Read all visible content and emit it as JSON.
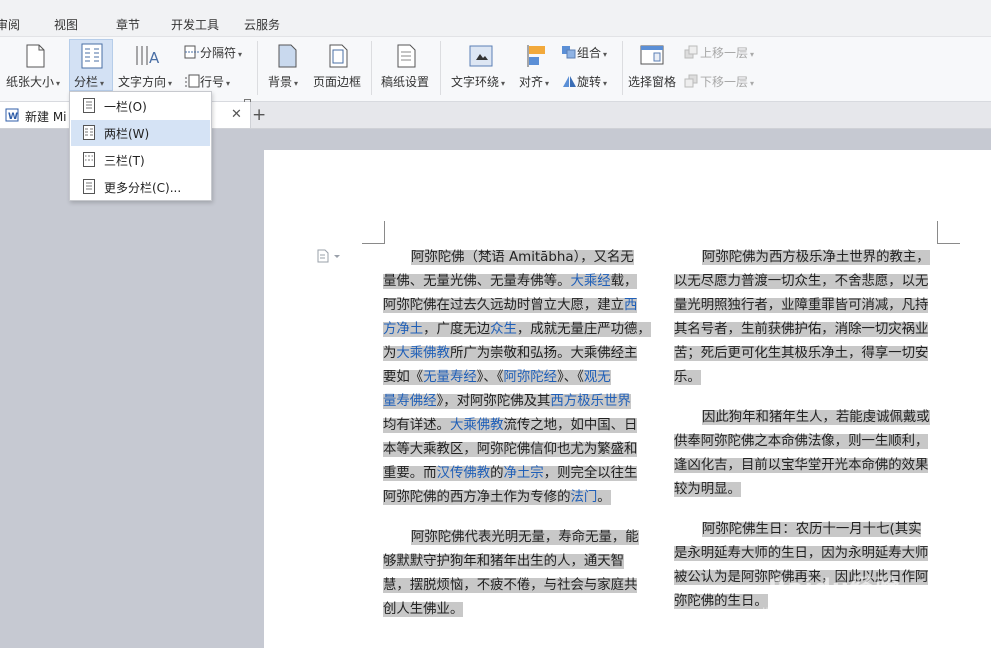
{
  "menubar": {
    "items": [
      "审阅",
      "视图",
      "章节",
      "开发工具",
      "云服务"
    ]
  },
  "ribbon": {
    "paper_size": "纸张大小",
    "columns": "分栏",
    "text_direction": "文字方向",
    "separator": "分隔符",
    "line_number": "行号",
    "background": "背景",
    "page_border": "页面边框",
    "manuscript": "稿纸设置",
    "text_wrap": "文字环绕",
    "align": "对齐",
    "group": "组合",
    "rotate": "旋转",
    "selection_pane": "选择窗格",
    "bring_forward": "上移一层",
    "send_backward": "下移一层"
  },
  "tabs": {
    "doc_title": "新建 Mi"
  },
  "dropdown": {
    "items": [
      "一栏(O)",
      "两栏(W)",
      "三栏(T)",
      "更多分栏(C)..."
    ],
    "selected": "两栏(W)"
  },
  "document": {
    "left_column": {
      "p1_lines": [
        [
          {
            "t": "阿弥陀佛（梵语 Amitābha），又名无"
          }
        ],
        [
          {
            "t": "量佛、无量光佛、无量寿佛等。"
          },
          {
            "t": "大乘经",
            "link": true
          },
          {
            "t": "载，"
          }
        ],
        [
          {
            "t": "阿弥陀佛在过去久远劫时曾立大愿，建立"
          },
          {
            "t": "西",
            "link": true
          }
        ],
        [
          {
            "t": "方净土",
            "link": true
          },
          {
            "t": "，广度无边"
          },
          {
            "t": "众生",
            "link": true
          },
          {
            "t": "，成就无量庄严功德，"
          }
        ],
        [
          {
            "t": "为"
          },
          {
            "t": "大乘佛教",
            "link": true
          },
          {
            "t": "所广为崇敬和弘扬。大乘佛经主"
          }
        ],
        [
          {
            "t": "要如《"
          },
          {
            "t": "无量寿经",
            "link": true
          },
          {
            "t": "》、《"
          },
          {
            "t": "阿弥陀经",
            "link": true
          },
          {
            "t": "》、《"
          },
          {
            "t": "观无",
            "link": true
          }
        ],
        [
          {
            "t": "量寿佛经",
            "link": true
          },
          {
            "t": "》，对阿弥陀佛及其"
          },
          {
            "t": "西方极乐世界",
            "link": true
          }
        ],
        [
          {
            "t": "均有详述。"
          },
          {
            "t": "大乘佛教",
            "link": true
          },
          {
            "t": "流传之地，如中国、日"
          }
        ],
        [
          {
            "t": "本等大乘教区，阿弥陀佛信仰也尤为繁盛和"
          }
        ],
        [
          {
            "t": "重要。而"
          },
          {
            "t": "汉传佛教",
            "link": true
          },
          {
            "t": "的"
          },
          {
            "t": "净土宗",
            "link": true
          },
          {
            "t": "，则完全以往生"
          }
        ],
        [
          {
            "t": "阿弥陀佛的西方净土作为专修的"
          },
          {
            "t": "法门",
            "link": true
          },
          {
            "t": "。"
          }
        ]
      ],
      "p2_lines": [
        [
          {
            "t": "阿弥陀佛代表光明无量，寿命无量，能"
          }
        ],
        [
          {
            "t": "够默默守护狗年和猪年出生的人，通天智"
          }
        ],
        [
          {
            "t": "慧，摆脱烦恼，不疲不倦，与社会与家庭共"
          }
        ],
        [
          {
            "t": "创人生佛业。"
          }
        ]
      ]
    },
    "right_column": {
      "p1_lines": [
        "阿弥陀佛为西方极乐净土世界的教主，",
        "以无尽愿力普渡一切众生，不舍悲愿，以无",
        "量光明照独行者，业障重罪皆可消减，凡持",
        "其名号者，生前获佛护佑，消除一切灾祸业",
        "苦；死后更可化生其极乐净土，得享一切安",
        "乐。"
      ],
      "p2_lines": [
        "因此狗年和猪年生人，若能虔诚佩戴或",
        "供奉阿弥陀佛之本命佛法像，则一生顺利，",
        "逢凶化吉，目前以宝华堂开光本命佛的效果",
        "较为明显。"
      ],
      "p3_lines": [
        "阿弥陀佛生日：农历十一月十七(其实",
        "是永明延寿大师的生日，因为永明延寿大师",
        "被公认为是阿弥陀佛再来，因此以此日作阿",
        "弥陀佛的生日。"
      ]
    }
  },
  "watermark": {
    "brand": "Baidu经验",
    "url": "jingyan.baidu.com"
  },
  "colors": {
    "link": "#1f5fb8",
    "highlight": "#c8c8c8",
    "selected_menu": "#d5e3f5"
  }
}
